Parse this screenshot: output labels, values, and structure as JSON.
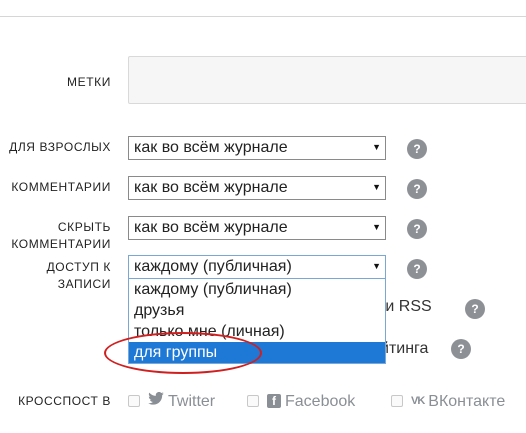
{
  "labels": {
    "tags": "МЕТКИ",
    "adult": "ДЛЯ ВЗРОСЛЫХ",
    "comments": "КОММЕНТАРИИ",
    "hide_comments_1": "СКРЫТЬ",
    "hide_comments_2": "КОММЕНТАРИИ",
    "access_1": "ДОСТУП К",
    "access_2": "ЗАПИСИ",
    "crosspost": "КРОССПОСТ В"
  },
  "selects": {
    "adult": "как во всём журнале",
    "comments": "как во всём журнале",
    "hide_comments": "как во всём журнале",
    "access": "каждому (публичная)"
  },
  "access_options": [
    "каждому (публичная)",
    "друзья",
    "только мне (личная)",
    "для группы"
  ],
  "access_active_index": 3,
  "help_glyph": "?",
  "arrow_glyph": "▼",
  "behind_text": {
    "rss": "й и RSS",
    "rating": "йтинга"
  },
  "crosspost": {
    "twitter": "Twitter",
    "facebook": "Facebook",
    "vk": "ВКонтакте",
    "facebook_icon_glyph": "f",
    "vk_icon_glyph": "VK"
  },
  "colors": {
    "highlight": "#1e78d6",
    "annotation": "#d01f1f"
  }
}
